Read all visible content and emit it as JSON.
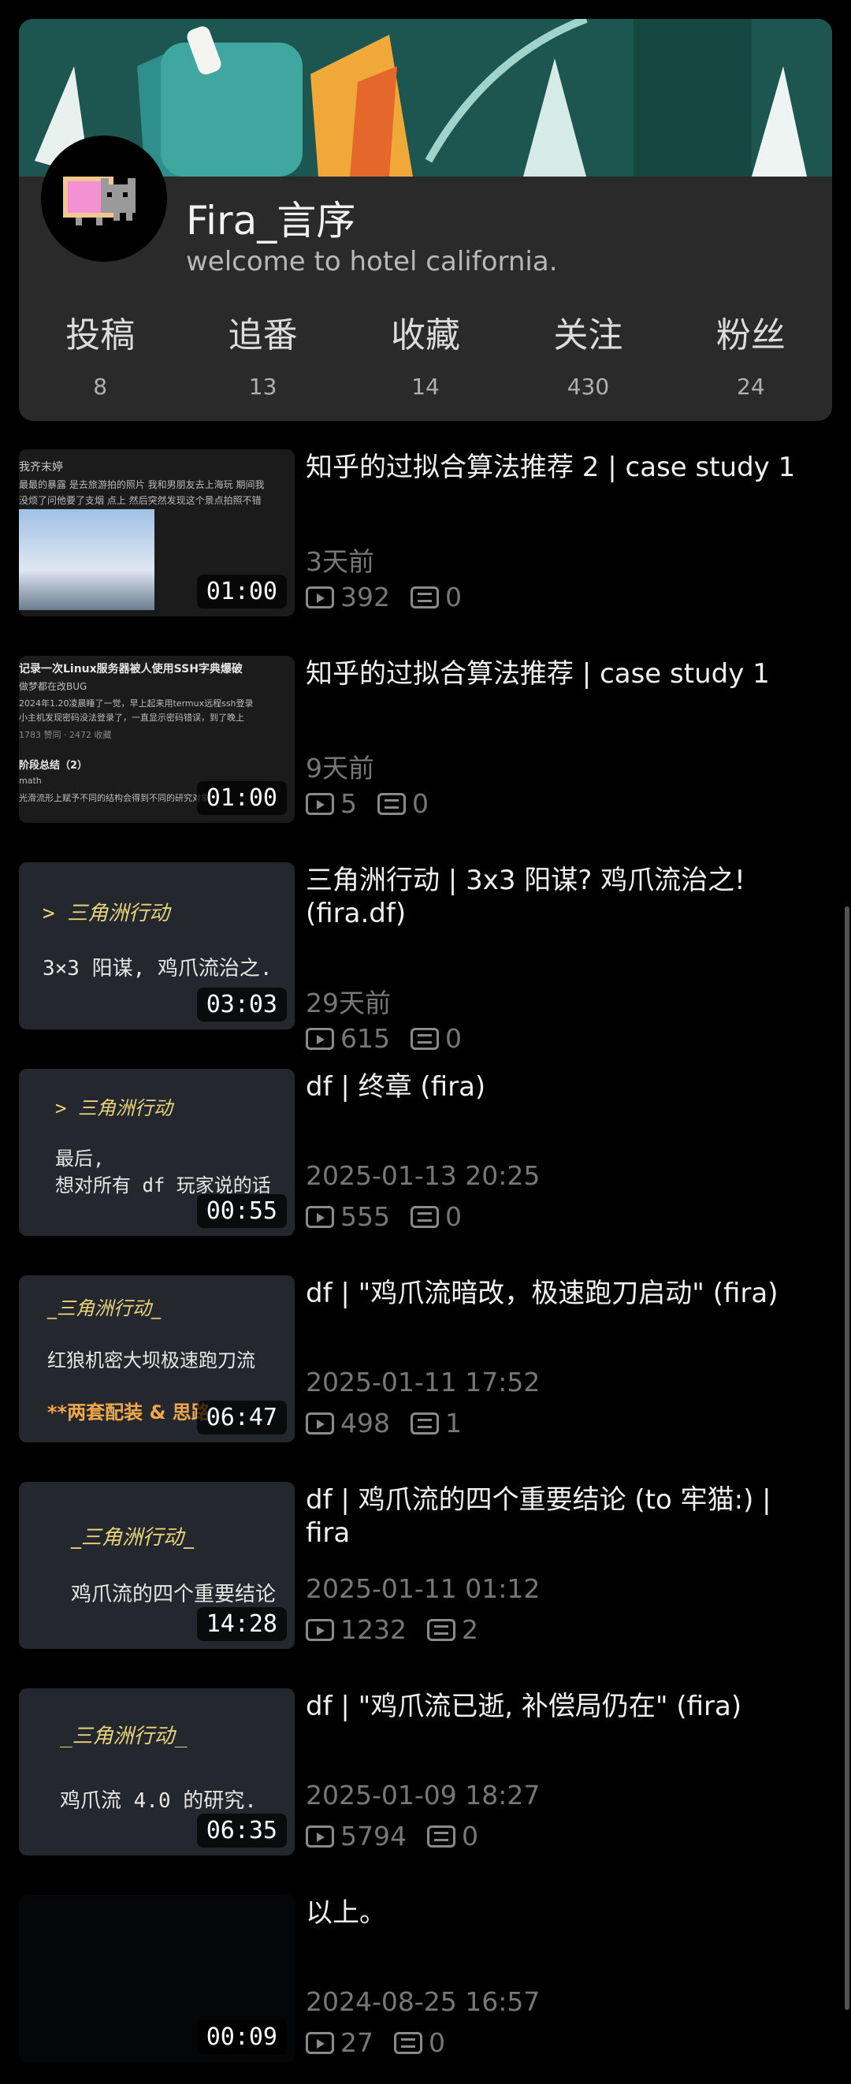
{
  "profile": {
    "username": "Fira_言序",
    "bio": "welcome to hotel california.",
    "stats": [
      {
        "label": "投稿",
        "value": "8"
      },
      {
        "label": "追番",
        "value": "13"
      },
      {
        "label": "收藏",
        "value": "14"
      },
      {
        "label": "关注",
        "value": "430"
      },
      {
        "label": "粉丝",
        "value": "24"
      }
    ]
  },
  "videos": [
    {
      "title": "知乎的过拟合算法推荐 2 | case study 1",
      "date": "3天前",
      "views": "392",
      "danmaku": "0",
      "duration": "01:00",
      "thumb_lines": [
        "我齐末婷",
        "最最的暴露 是去旅游拍的照片  我和男朋友去上海玩 期间我",
        "没烦了问他要了支烟 点上 然后突然发现这个景点拍照不错"
      ]
    },
    {
      "title": "知乎的过拟合算法推荐 | case study 1",
      "date": "9天前",
      "views": "5",
      "danmaku": "0",
      "duration": "01:00",
      "thumb_lines": [
        "记录一次Linux服务器被人使用SSH字典爆破",
        "做梦都在改BUG",
        "2024年1.20凌晨睡了一觉，早上起来用termux远程ssh登录",
        "小主机发现密码没法登录了，一直显示密码错误，到了晚上",
        "1783 赞同 · 2472 收藏",
        "阶段总结（2）",
        "math",
        "光滑流形上赋予不同的结构会得到不同的研究对象"
      ]
    },
    {
      "title": "三角洲行动 | 3x3 阳谋? 鸡爪流治之! (fira.df)",
      "date": "29天前",
      "views": "615",
      "danmaku": "0",
      "duration": "03:03",
      "thumb_lines": [
        "> 三角洲行动",
        "3×3 阳谋, 鸡爪流治之."
      ]
    },
    {
      "title": "df | 终章 (fira)",
      "date": "2025-01-13 20:25",
      "views": "555",
      "danmaku": "0",
      "duration": "00:55",
      "thumb_lines": [
        "> 三角洲行动",
        "最后,",
        "想对所有 df 玩家说的话"
      ]
    },
    {
      "title": "df | \"鸡爪流暗改，极速跑刀启动\" (fira)",
      "date": "2025-01-11 17:52",
      "views": "498",
      "danmaku": "1",
      "duration": "06:47",
      "thumb_lines": [
        "_三角洲行动_",
        "红狼机密大坝极速跑刀流",
        "**两套配装 & 思路"
      ]
    },
    {
      "title": "df | 鸡爪流的四个重要结论 (to 牢猫:) | fira",
      "date": "2025-01-11 01:12",
      "views": "1232",
      "danmaku": "2",
      "duration": "14:28",
      "thumb_lines": [
        "_三角洲行动_",
        "鸡爪流的四个重要结论"
      ]
    },
    {
      "title": "df | \"鸡爪流已逝, 补偿局仍在\" (fira)",
      "date": "2025-01-09 18:27",
      "views": "5794",
      "danmaku": "0",
      "duration": "06:35",
      "thumb_lines": [
        "_三角洲行动_",
        "鸡爪流 4.0 的研究."
      ]
    },
    {
      "title": "以上。",
      "date": "2024-08-25 16:57",
      "views": "27",
      "danmaku": "0",
      "duration": "00:09",
      "thumb_lines": []
    }
  ]
}
